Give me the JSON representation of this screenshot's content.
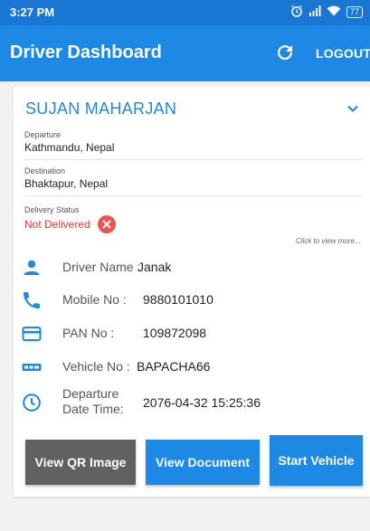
{
  "status_bar": {
    "time": "3:27 PM",
    "battery": "77"
  },
  "app_bar": {
    "title": "Driver Dashboard",
    "logout_label": "LOGOUT"
  },
  "driver_card": {
    "name": "SUJAN  MAHARJAN",
    "departure": {
      "label": "Departure",
      "value": "Kathmandu, Nepal"
    },
    "destination": {
      "label": "Destination",
      "value": "Bhaktapur, Nepal"
    },
    "delivery_status": {
      "label": "Delivery Status",
      "value": "Not Delivered"
    },
    "click_more": "Click to view more...",
    "details": {
      "driver_name": {
        "label": "Driver Name :",
        "value": "Janak"
      },
      "mobile": {
        "label": "Mobile No :",
        "value": "9880101010"
      },
      "pan": {
        "label": "PAN No :",
        "value": "109872098"
      },
      "vehicle": {
        "label": "Vehicle No :",
        "value": "BAPACHA66"
      },
      "departure_time": {
        "label": "Departure Date Time:",
        "value": "2076-04-32 15:25:36"
      }
    }
  },
  "buttons": {
    "view_qr": "View QR Image",
    "view_document": "View Document",
    "start_vehicle": "Start Vehicle"
  },
  "colors": {
    "status_bar": "#1976d2",
    "app_bar": "#1e88e5",
    "accent": "#1e88e5",
    "danger": "#e53935",
    "grey_button": "#616161"
  },
  "icons": {
    "status_bar": [
      "alarm-icon",
      "signal-icon",
      "wifi-icon",
      "battery-icon"
    ],
    "app_bar": [
      "refresh-icon"
    ],
    "card": [
      "chevron-down-icon",
      "close-circle-icon",
      "person-icon",
      "phone-icon",
      "card-icon",
      "vehicle-plate-icon",
      "clock-icon"
    ]
  }
}
